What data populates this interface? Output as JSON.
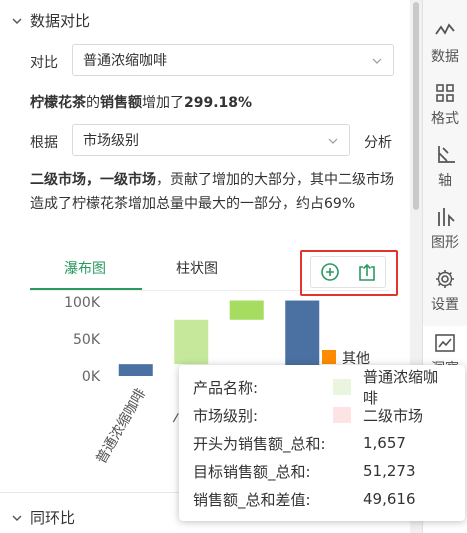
{
  "section_compare": {
    "title": "数据对比"
  },
  "compare_row": {
    "label": "对比",
    "value": "普通浓缩咖啡"
  },
  "headline": {
    "product": "柠檬花茶",
    "de": "的",
    "metric": "销售额",
    "verb": "增加了",
    "percent": "299.18%"
  },
  "basis_row": {
    "label": "根据",
    "value": "市场级别",
    "analyze": "分析"
  },
  "insight": {
    "bold": "二级市场，一级市场",
    "text": "，贡献了增加的大部分，其中二级市场造成了柠檬花茶增加总量中最大的一部分，约占69%"
  },
  "tabs": [
    {
      "label": "瀑布图"
    },
    {
      "label": "柱状图"
    }
  ],
  "tools": {
    "add": "add-icon",
    "export": "export-icon"
  },
  "chart_data": {
    "type": "bar",
    "subtype": "waterfall",
    "categories": [
      "普通浓缩咖啡",
      "二级市场",
      "一级市场",
      "柠檬花茶"
    ],
    "x_tick_labels": [
      "普通浓缩咖啡",
      "二级市",
      "",
      "茶"
    ],
    "bars": [
      {
        "category": "普通浓缩咖啡",
        "start": 0,
        "end": 16000,
        "color": "#4a71a1"
      },
      {
        "category": "二级市场",
        "start": 16000,
        "end": 76000,
        "color": "#c5e89b"
      },
      {
        "category": "一级市场",
        "start": 76000,
        "end": 102000,
        "color": "#a6dd60"
      },
      {
        "category": "柠檬花茶",
        "start": 0,
        "end": 102000,
        "color": "#4a71a1"
      }
    ],
    "yticks": [
      "100K",
      "50K",
      "0K"
    ],
    "ytick_values": [
      100000,
      50000,
      0
    ],
    "ylim": [
      0,
      100000
    ],
    "legend": [
      {
        "name": "其他",
        "color": "#ff8c00"
      }
    ],
    "legend_placement": "right"
  },
  "bottom_section": {
    "title": "同环比"
  },
  "sidebar": {
    "items": [
      {
        "label": "数据",
        "icon": "line-chart-icon"
      },
      {
        "label": "格式",
        "icon": "grid-icon"
      },
      {
        "label": "轴",
        "icon": "axis-icon"
      },
      {
        "label": "图形",
        "icon": "bar-graph-icon"
      },
      {
        "label": "设置",
        "icon": "gear-icon"
      },
      {
        "label": "洞察",
        "icon": "insight-icon"
      }
    ]
  },
  "tooltip": {
    "rows": [
      {
        "key": "产品名称:",
        "value": "普通浓缩咖啡"
      },
      {
        "key": "市场级别:",
        "value": "二级市场"
      },
      {
        "key": "开头为销售额_总和:",
        "value": "1,657"
      },
      {
        "key": "目标销售额_总和:",
        "value": "51,273"
      },
      {
        "key": "销售额_总和差值:",
        "value": "49,616"
      }
    ],
    "swatches": [
      "#e9f5de",
      "#fde3e3"
    ]
  }
}
